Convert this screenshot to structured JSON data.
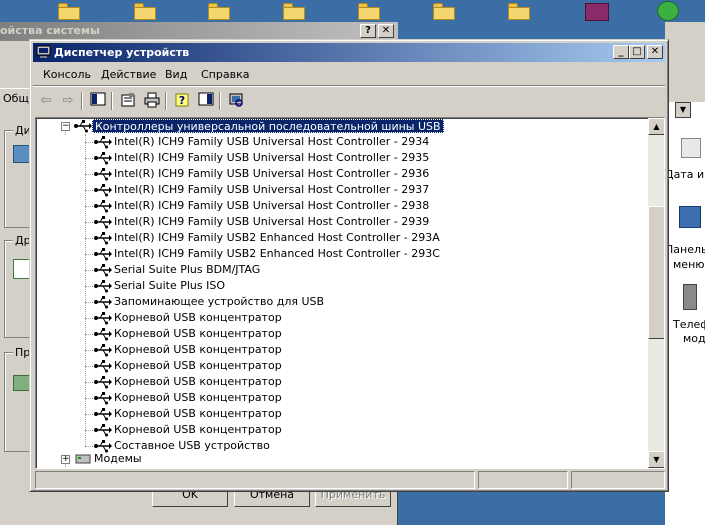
{
  "background_window": {
    "title": "ойства системы",
    "tab_label": "Общ",
    "group_labels": [
      "Дис",
      "Дра",
      "Про"
    ],
    "buttons": {
      "ok": "OK",
      "cancel": "Отмена",
      "apply": "Применить"
    }
  },
  "background_panel": {
    "labels": [
      "Дата и в",
      "Панель у",
      "меню \"",
      "Телеф",
      "моде"
    ]
  },
  "device_manager": {
    "title": "Диспетчер устройств",
    "menu": [
      {
        "label": "Консоль"
      },
      {
        "label": "Действие"
      },
      {
        "label": "Вид"
      },
      {
        "label": "Справка"
      }
    ],
    "toolbar_icons": [
      "back-icon",
      "forward-icon",
      "show-hide-tree-icon",
      "properties-icon",
      "print-icon",
      "help-icon",
      "show-hide-action-pane-icon",
      "scan-hardware-icon"
    ],
    "tree": {
      "category": "Контроллеры универсальной последовательной шины USB",
      "children": [
        "Intel(R) ICH9 Family USB Universal Host Controller - 2934",
        "Intel(R) ICH9 Family USB Universal Host Controller - 2935",
        "Intel(R) ICH9 Family USB Universal Host Controller - 2936",
        "Intel(R) ICH9 Family USB Universal Host Controller - 2937",
        "Intel(R) ICH9 Family USB Universal Host Controller - 2938",
        "Intel(R) ICH9 Family USB Universal Host Controller - 2939",
        "Intel(R) ICH9 Family USB2 Enhanced Host Controller - 293A",
        "Intel(R) ICH9 Family USB2 Enhanced Host Controller - 293C",
        "Serial Suite Plus BDM/JTAG",
        "Serial Suite Plus ISO",
        "Запоминающее устройство для USB",
        "Корневой USB концентратор",
        "Корневой USB концентратор",
        "Корневой USB концентратор",
        "Корневой USB концентратор",
        "Корневой USB концентратор",
        "Корневой USB концентратор",
        "Корневой USB концентратор",
        "Корневой USB концентратор",
        "Составное USB устройство"
      ],
      "next_category": "Модемы"
    }
  },
  "colors": {
    "title_active_start": "#0a246a",
    "title_active_end": "#a6caf0",
    "face": "#d4d0c8",
    "desktop": "#3a6ea5"
  }
}
